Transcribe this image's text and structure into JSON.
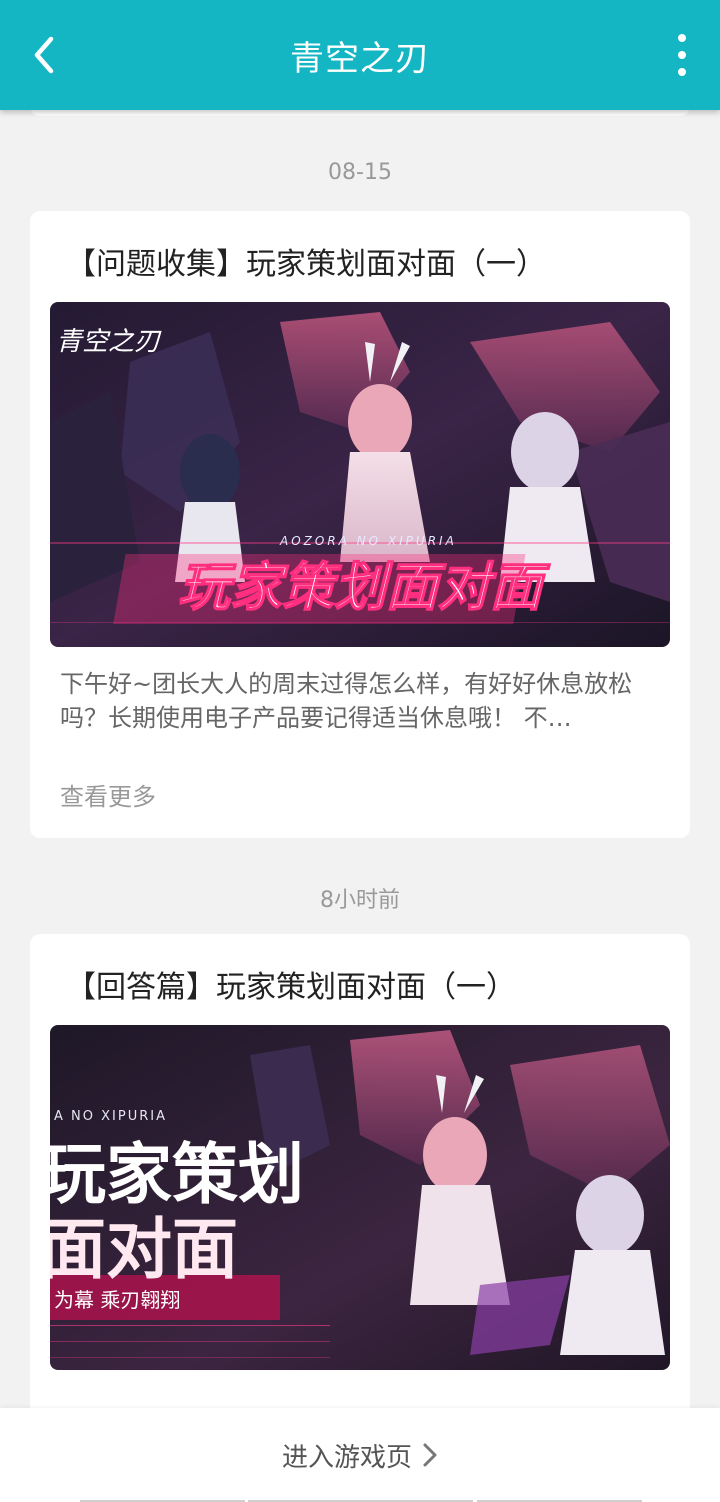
{
  "header": {
    "title": "青空之刃",
    "back_icon": "chevron-left-icon",
    "more_icon": "more-vertical-icon",
    "bg_color": "#15b6c3"
  },
  "posts": [
    {
      "date": "08-15",
      "title": "【问题收集】玩家策划面对面（一）",
      "banner": {
        "main_text": "玩家策划面对面",
        "sub_text": "AOZORA NO XIPURIA",
        "logo_text": "青空之刃"
      },
      "excerpt": "下午好~团长大人的周末过得怎么样，有好好休息放松吗？长期使用电子产品要记得适当休息哦！ 不…",
      "more_label": "查看更多"
    },
    {
      "date": "8小时前",
      "title": "【回答篇】玩家策划面对面（一）",
      "banner": {
        "line1": "玩家策划",
        "line2": "面对面",
        "sub_text": "A NO XIPURIA",
        "tagline": "为幕  乘刃翱翔"
      }
    }
  ],
  "bottom": {
    "enter_label": "进入游戏页",
    "chevron_icon": "chevron-right-icon"
  }
}
